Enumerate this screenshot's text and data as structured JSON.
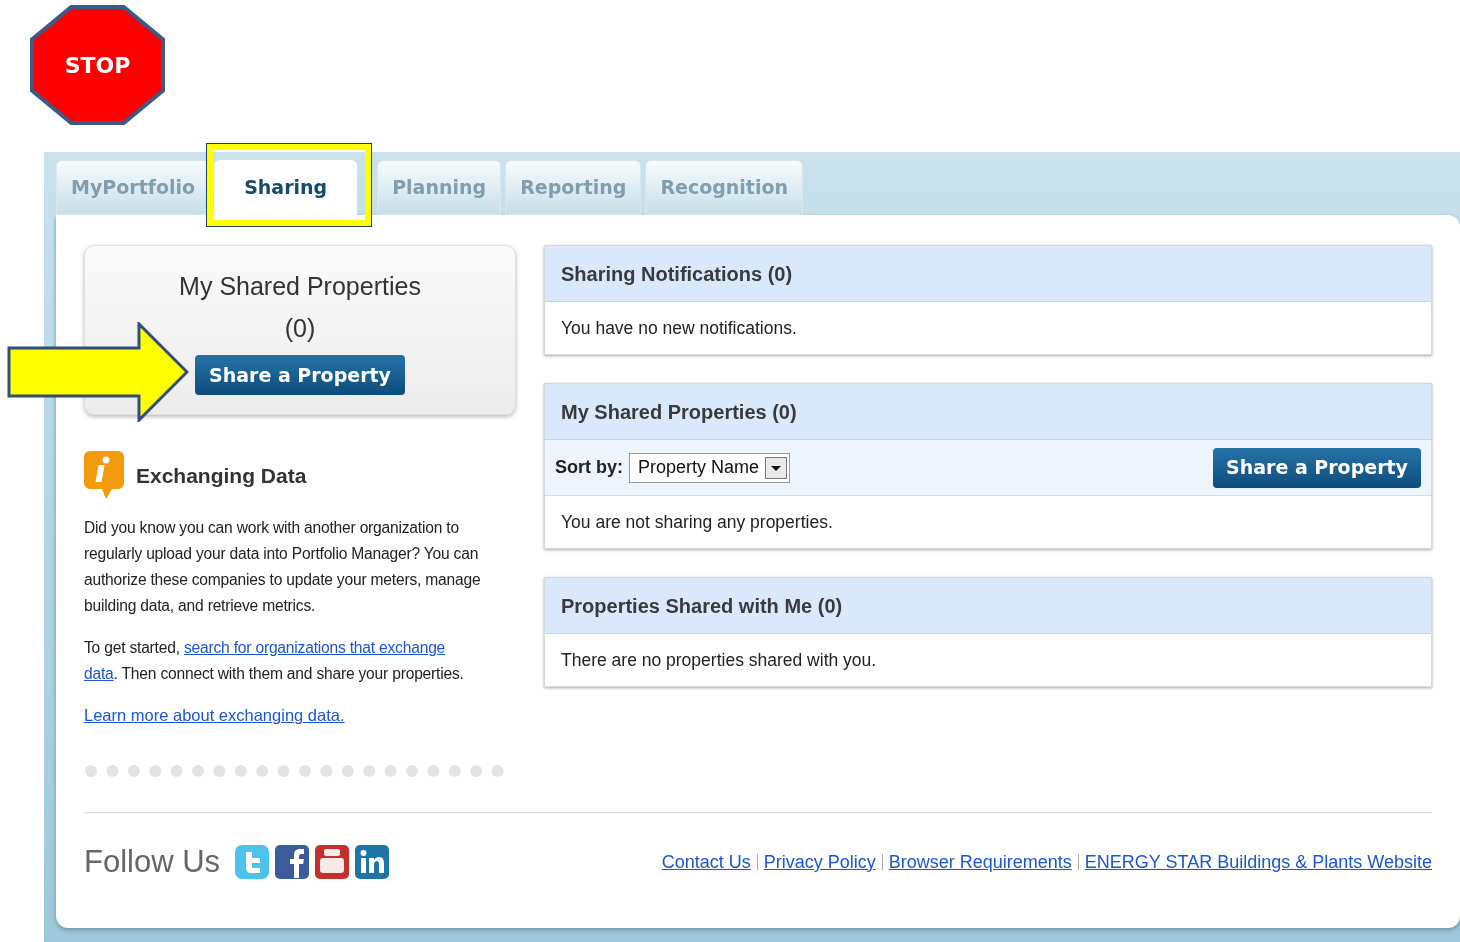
{
  "annotations": {
    "stop_sign": "STOP"
  },
  "tabs": [
    {
      "label": "MyPortfolio",
      "selected": false
    },
    {
      "label": "Sharing",
      "selected": true
    },
    {
      "label": "Planning",
      "selected": false
    },
    {
      "label": "Reporting",
      "selected": false
    },
    {
      "label": "Recognition",
      "selected": false
    }
  ],
  "shared_box": {
    "title": "My Shared Properties",
    "count": "(0)",
    "button": "Share a Property"
  },
  "info": {
    "title": "Exchanging Data",
    "paragraph": "Did you know you can work with another organization to regularly upload your data into Portfolio Manager? You can authorize these companies to update your meters, manage building data, and retrieve metrics.",
    "start_prefix": "To get started, ",
    "start_link": [
      "search for organizations that exchange",
      "data"
    ],
    "start_suffix": ". Then connect with them and share your properties.",
    "learn_more": "Learn more about exchanging data."
  },
  "panels": [
    {
      "title": "Sharing Notifications (0)",
      "message": "You have no new notifications."
    },
    {
      "title": "My Shared Properties (0)",
      "sort_label": "Sort by:",
      "sort_value": "Property Name",
      "button": "Share a Property",
      "message": "You are not sharing any properties."
    },
    {
      "title": "Properties Shared with Me (0)",
      "message": "There are no properties shared with you."
    }
  ],
  "footer": {
    "follow": "Follow Us",
    "links": [
      "Contact Us",
      "Privacy Policy",
      "Browser Requirements",
      "ENERGY STAR Buildings & Plants Website"
    ]
  }
}
